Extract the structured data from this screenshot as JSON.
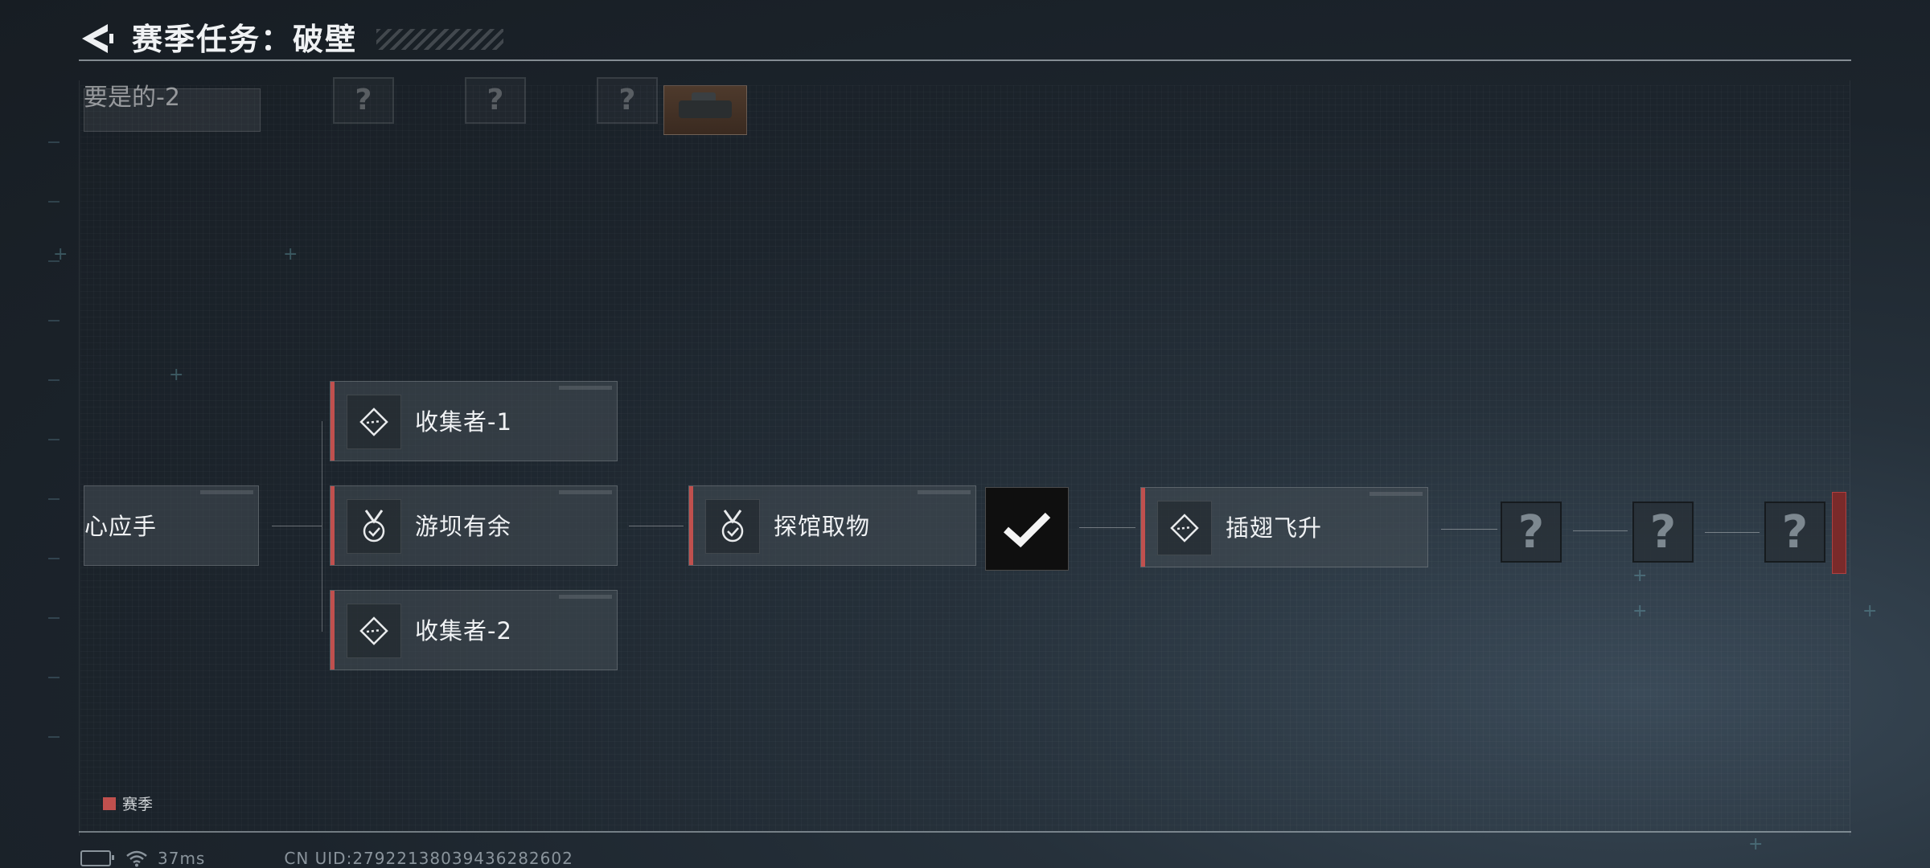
{
  "header": {
    "title": "赛季任务：破壁"
  },
  "partial_top": {
    "fade_title": "要是的-2"
  },
  "nodes": {
    "left_partial": "心应手",
    "collector_1": "收集者-1",
    "dam_extra": "游坝有余",
    "collector_2": "收集者-2",
    "explore": "探馆取物",
    "fly": "插翅飞升"
  },
  "unknown_nodes": [
    "?",
    "?",
    "?"
  ],
  "upper_unknown": [
    "?",
    "?",
    "?"
  ],
  "legend": {
    "season": "赛季"
  },
  "status": {
    "ping": "37ms",
    "uid": "CN UID:27922138039436282602"
  },
  "colors": {
    "season_accent": "#c0504e"
  }
}
